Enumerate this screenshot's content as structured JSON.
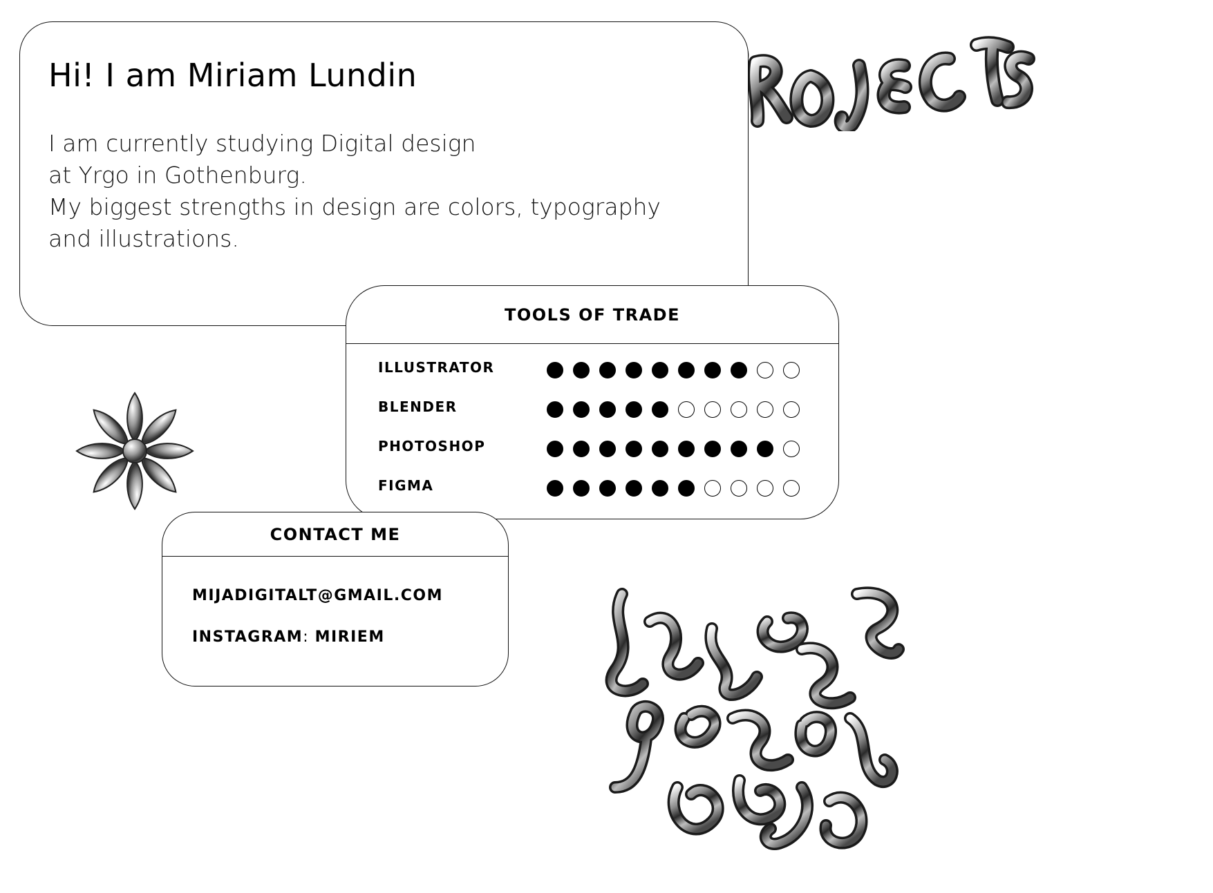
{
  "intro": {
    "title": "Hi! I am Miriam Lundin",
    "lines": [
      "I am currently studying Digital design",
      "at Yrgo in Gothenburg.",
      "My biggest strengths in design are colors, typography",
      "and illustrations."
    ]
  },
  "tools": {
    "title": "TOOLS OF TRADE",
    "max_level": 10,
    "items": [
      {
        "name": "ILLUSTRATOR",
        "level": 8
      },
      {
        "name": "BLENDER",
        "level": 5
      },
      {
        "name": "PHOTOSHOP",
        "level": 9
      },
      {
        "name": "FIGMA",
        "level": 6
      }
    ]
  },
  "contact": {
    "title": "CONTACT ME",
    "email": "MIJADIGITALT@GMAIL.COM",
    "instagram_label": "INSTAGRAM",
    "instagram_handle": "MIRIEM"
  },
  "decorations": {
    "projects_word": "PROJECTS",
    "flower": "chrome-flower-icon",
    "instagram_art": "chrome-instagram-lettering"
  },
  "colors": {
    "background": "#ffffff",
    "ink": "#000000",
    "chrome_light": "#f2f2f2",
    "chrome_dark": "#2a2a2a"
  }
}
